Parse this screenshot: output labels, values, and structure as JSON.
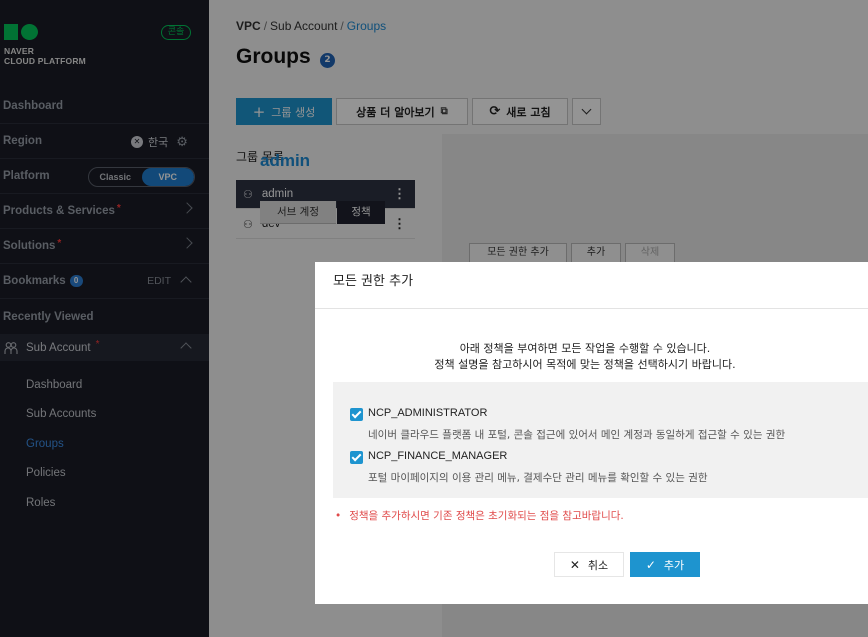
{
  "brand": {
    "line1": "NAVER",
    "line2": "CLOUD PLATFORM",
    "console_badge": "콘솔",
    "color": "#03c75a"
  },
  "sidebar": {
    "dashboard": "Dashboard",
    "region_label": "Region",
    "region_value": "한국",
    "platform_label": "Platform",
    "platform_options": [
      "Classic",
      "VPC"
    ],
    "platform_selected": "VPC",
    "products": "Products & Services",
    "solutions": "Solutions",
    "bookmarks": "Bookmarks",
    "bookmarks_count": "0",
    "bookmarks_edit": "EDIT",
    "recently_viewed": "Recently Viewed",
    "sub_account": "Sub Account",
    "required_mark": "*",
    "sub_items": [
      "Dashboard",
      "Sub Accounts",
      "Groups",
      "Policies",
      "Roles"
    ],
    "active_sub_item": "Groups"
  },
  "breadcrumb": [
    "VPC",
    "Sub Account",
    "Groups"
  ],
  "page": {
    "title": "Groups",
    "count": "2"
  },
  "toolbar": {
    "create": "그룹 생성",
    "learn_more": "상품 더 알아보기",
    "refresh": "새로 고침"
  },
  "group_list": {
    "title": "그룹 목록",
    "items": [
      "admin",
      "dev"
    ],
    "selected": "admin"
  },
  "detail": {
    "title": "admin",
    "tabs": [
      "서브 계정",
      "정책"
    ],
    "active_tab": "정책",
    "policy_buttons": [
      "모든 권한 추가",
      "추가",
      "삭제"
    ]
  },
  "modal": {
    "title": "모든 권한 추가",
    "desc_line1": "아래 정책을 부여하면 모든 작업을 수행할 수 있습니다.",
    "desc_line2": "정책 설명을 참고하시어 목적에 맞는 정책을 선택하시기 바랍니다.",
    "policies": [
      {
        "name": "NCP_ADMINISTRATOR",
        "desc": "네이버 클라우드 플랫폼 내 포털, 콘솔 접근에 있어서 메인 계정과 동일하게 접근할 수 있는 권한",
        "checked": true
      },
      {
        "name": "NCP_FINANCE_MANAGER",
        "desc": "포털 마이페이지의 이용 관리 메뉴, 결제수단 관리 메뉴를 확인할 수 있는 권한",
        "checked": true
      }
    ],
    "note": "정책을 추가하시면 기존 정책은 초기화되는 점을 참고바랍니다.",
    "cancel": "취소",
    "add": "추가"
  },
  "colors": {
    "accent": "#1e94cf",
    "sidebar_bg": "#1a1d26",
    "active_link": "#3d8ee8",
    "warning": "#e04a4a"
  }
}
